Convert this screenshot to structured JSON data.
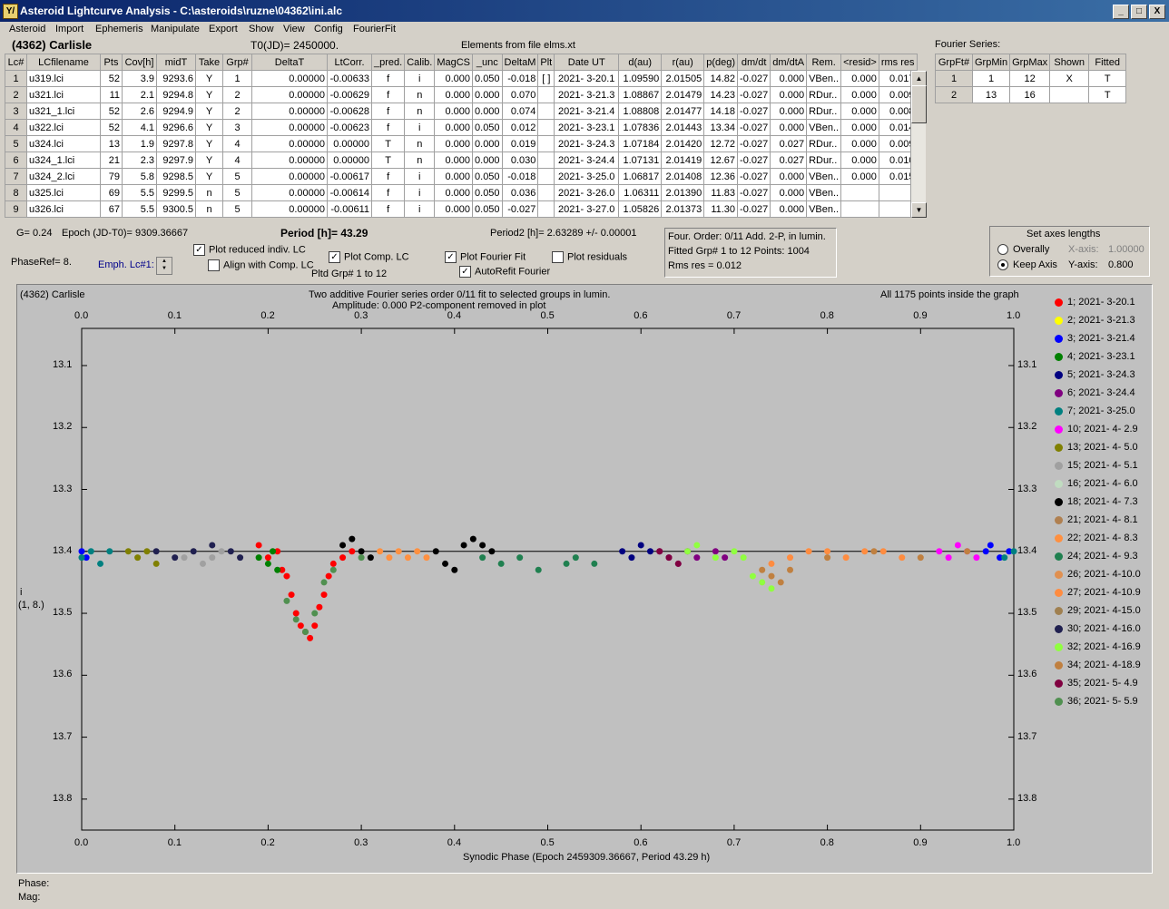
{
  "window": {
    "title": "Asteroid Lightcurve Analysis - C:\\asteroids\\ruzne\\04362\\ini.alc",
    "app_icon": "Y/",
    "min": "_",
    "max": "□",
    "close": "X"
  },
  "menu": [
    "Asteroid",
    "Import",
    "Ephemeris",
    "Manipulate",
    "Export",
    "Show",
    "View",
    "Config",
    "FourierFit"
  ],
  "header": {
    "object": "(4362) Carlisle",
    "t0": "T0(JD)= 2450000.",
    "elements": "Elements from file elms.xt",
    "fourier_label": "Fourier Series:"
  },
  "table": {
    "columns": [
      "Lc#",
      "LCfilename",
      "Pts",
      "Cov[h]",
      "midT",
      "Take",
      "Grp#",
      "DeltaT",
      "LtCorr.",
      "_pred.",
      "Calib.",
      "MagCS",
      "_unc",
      "DeltaM",
      "Plt",
      "Date UT",
      "d(au)",
      "r(au)",
      "p(deg)",
      "dm/dt",
      "dm/dtA",
      "Rem.",
      "<resid>",
      "rms res"
    ],
    "rows": [
      [
        "1",
        "u319.lci",
        "52",
        "3.9",
        "9293.6",
        "Y",
        "1",
        "0.00000",
        "-0.00633",
        "f",
        "i",
        "0.000",
        "0.050",
        "-0.018",
        "[ ]",
        "2021- 3-20.1",
        "1.09590",
        "2.01505",
        "14.82",
        "-0.027",
        "0.000",
        "VBen..",
        "0.000",
        "0.017"
      ],
      [
        "2",
        "u321.lci",
        "11",
        "2.1",
        "9294.8",
        "Y",
        "2",
        "0.00000",
        "-0.00629",
        "f",
        "n",
        "0.000",
        "0.000",
        "0.070",
        "",
        "2021- 3-21.3",
        "1.08867",
        "2.01479",
        "14.23",
        "-0.027",
        "0.000",
        "RDur..",
        "0.000",
        "0.009"
      ],
      [
        "3",
        "u321_1.lci",
        "52",
        "2.6",
        "9294.9",
        "Y",
        "2",
        "0.00000",
        "-0.00628",
        "f",
        "n",
        "0.000",
        "0.000",
        "0.074",
        "",
        "2021- 3-21.4",
        "1.08808",
        "2.01477",
        "14.18",
        "-0.027",
        "0.000",
        "RDur..",
        "0.000",
        "0.008"
      ],
      [
        "4",
        "u322.lci",
        "52",
        "4.1",
        "9296.6",
        "Y",
        "3",
        "0.00000",
        "-0.00623",
        "f",
        "i",
        "0.000",
        "0.050",
        "0.012",
        "",
        "2021- 3-23.1",
        "1.07836",
        "2.01443",
        "13.34",
        "-0.027",
        "0.000",
        "VBen..",
        "0.000",
        "0.014"
      ],
      [
        "5",
        "u324.lci",
        "13",
        "1.9",
        "9297.8",
        "Y",
        "4",
        "0.00000",
        "0.00000",
        "T",
        "n",
        "0.000",
        "0.000",
        "0.019",
        "",
        "2021- 3-24.3",
        "1.07184",
        "2.01420",
        "12.72",
        "-0.027",
        "0.027",
        "RDur..",
        "0.000",
        "0.009"
      ],
      [
        "6",
        "u324_1.lci",
        "21",
        "2.3",
        "9297.9",
        "Y",
        "4",
        "0.00000",
        "0.00000",
        "T",
        "n",
        "0.000",
        "0.000",
        "0.030",
        "",
        "2021- 3-24.4",
        "1.07131",
        "2.01419",
        "12.67",
        "-0.027",
        "0.027",
        "RDur..",
        "0.000",
        "0.010"
      ],
      [
        "7",
        "u324_2.lci",
        "79",
        "5.8",
        "9298.5",
        "Y",
        "5",
        "0.00000",
        "-0.00617",
        "f",
        "i",
        "0.000",
        "0.050",
        "-0.018",
        "",
        "2021- 3-25.0",
        "1.06817",
        "2.01408",
        "12.36",
        "-0.027",
        "0.000",
        "VBen..",
        "0.000",
        "0.015"
      ],
      [
        "8",
        "u325.lci",
        "69",
        "5.5",
        "9299.5",
        "n",
        "5",
        "0.00000",
        "-0.00614",
        "f",
        "i",
        "0.000",
        "0.050",
        "0.036",
        "",
        "2021- 3-26.0",
        "1.06311",
        "2.01390",
        "11.83",
        "-0.027",
        "0.000",
        "VBen..",
        "",
        ""
      ],
      [
        "9",
        "u326.lci",
        "67",
        "5.5",
        "9300.5",
        "n",
        "5",
        "0.00000",
        "-0.00611",
        "f",
        "i",
        "0.000",
        "0.050",
        "-0.027",
        "",
        "2021- 3-27.0",
        "1.05826",
        "2.01373",
        "11.30",
        "-0.027",
        "0.000",
        "VBen..",
        "",
        ""
      ]
    ]
  },
  "fourier_table": {
    "columns": [
      "GrpFt#",
      "GrpMin",
      "GrpMax",
      "Shown",
      "Fitted"
    ],
    "rows": [
      [
        "1",
        "1",
        "12",
        "X",
        "T"
      ],
      [
        "2",
        "13",
        "16",
        "",
        "T"
      ]
    ]
  },
  "controls": {
    "g": "G= 0.24",
    "epoch": "Epoch (JD-T0)= 9309.36667",
    "period": "Period [h]= 43.29",
    "period2": "Period2 [h]= 2.63289 +/- 0.00001",
    "phaseref": "PhaseRef= 8.",
    "emph": "Emph. Lc#1:",
    "plot_reduced": "Plot reduced indiv. LC",
    "align": "Align with Comp. LC",
    "plot_comp": "Plot Comp. LC",
    "pltd_grp": "Pltd Grp#  1   to   12",
    "plot_fourier": "Plot Fourier Fit",
    "autorefit": "AutoRefit Fourier",
    "plot_residuals": "Plot residuals",
    "info1": "Four. Order:  0/11     Add. 2-P, in lumin.",
    "info2": "Fitted Grp# 1 to 12    Points: 1004",
    "info3": "Rms res      = 0.012",
    "axes_title": "Set axes lengths",
    "overally": "Overally",
    "keep_axis": "Keep Axis",
    "xaxis_label": "X-axis:",
    "xaxis_val": "1.00000",
    "yaxis_label": "Y-axis:",
    "yaxis_val": "0.800",
    "check": "✓",
    "spin_up": "▲",
    "spin_down": "▼"
  },
  "plot": {
    "object": "(4362) Carlisle",
    "title1": "Two additive Fourier series order 0/11 fit to selected groups in lumin.",
    "title2": "Amplitude: 0.000                    P2-component removed in plot",
    "inside": "All 1175 points inside the graph",
    "xlabel": "Synodic Phase (Epoch 2459309.36667, Period 43.29 h)",
    "ylabel1": "i",
    "ylabel2": "(1, 8.)",
    "xticks": [
      "0.0",
      "0.1",
      "0.2",
      "0.3",
      "0.4",
      "0.5",
      "0.6",
      "0.7",
      "0.8",
      "0.9",
      "1.0"
    ],
    "yticks": [
      "13.1",
      "13.2",
      "13.3",
      "13.4",
      "13.5",
      "13.6",
      "13.7",
      "13.8"
    ]
  },
  "legend": [
    {
      "label": "1; 2021- 3-20.1",
      "color": "#ff0000"
    },
    {
      "label": "2; 2021- 3-21.3",
      "color": "#ffff00"
    },
    {
      "label": "3; 2021- 3-21.4",
      "color": "#0000ff"
    },
    {
      "label": "4; 2021- 3-23.1",
      "color": "#008000"
    },
    {
      "label": "5; 2021- 3-24.3",
      "color": "#000080"
    },
    {
      "label": "6; 2021- 3-24.4",
      "color": "#800080"
    },
    {
      "label": "7; 2021- 3-25.0",
      "color": "#008080"
    },
    {
      "label": "10; 2021- 4- 2.9",
      "color": "#ff00ff"
    },
    {
      "label": "13; 2021- 4- 5.0",
      "color": "#808000"
    },
    {
      "label": "15; 2021- 4- 5.1",
      "color": "#a0a0a0"
    },
    {
      "label": "16; 2021- 4- 6.0",
      "color": "#c0dcc0"
    },
    {
      "label": "18; 2021- 4- 7.3",
      "color": "#000000"
    },
    {
      "label": "21; 2021- 4- 8.1",
      "color": "#b08050"
    },
    {
      "label": "22; 2021- 4- 8.3",
      "color": "#ff9040"
    },
    {
      "label": "24; 2021- 4- 9.3",
      "color": "#208050"
    },
    {
      "label": "26; 2021- 4-10.0",
      "color": "#e09050"
    },
    {
      "label": "27; 2021- 4-10.9",
      "color": "#ff8c40"
    },
    {
      "label": "29; 2021- 4-15.0",
      "color": "#a08050"
    },
    {
      "label": "30; 2021- 4-16.0",
      "color": "#202050"
    },
    {
      "label": "32; 2021- 4-16.9",
      "color": "#90ff40"
    },
    {
      "label": "34; 2021- 4-18.9",
      "color": "#c08040"
    },
    {
      "label": "35; 2021- 5- 4.9",
      "color": "#800040"
    },
    {
      "label": "36; 2021- 5- 5.9",
      "color": "#509050"
    }
  ],
  "status": {
    "phase": "Phase:",
    "mag": "Mag:"
  },
  "chart_data": {
    "type": "scatter",
    "title": "Two additive Fourier series order 0/11 fit to selected groups in lumin.",
    "xlabel": "Synodic Phase (Epoch 2459309.36667, Period 43.29 h)",
    "ylabel": "i (1, 8.)",
    "xlim": [
      0.0,
      1.0
    ],
    "ylim": [
      13.04,
      13.85
    ],
    "y_inverted": true,
    "fit_line_y": 13.4,
    "series": [
      {
        "name": "1; 2021- 3-20.1",
        "color": "#ff0000",
        "points": [
          [
            0.19,
            13.39
          ],
          [
            0.2,
            13.41
          ],
          [
            0.21,
            13.4
          ],
          [
            0.215,
            13.43
          ],
          [
            0.22,
            13.44
          ],
          [
            0.225,
            13.47
          ],
          [
            0.23,
            13.5
          ],
          [
            0.235,
            13.52
          ],
          [
            0.24,
            13.53
          ],
          [
            0.245,
            13.54
          ],
          [
            0.25,
            13.52
          ],
          [
            0.255,
            13.49
          ],
          [
            0.26,
            13.47
          ],
          [
            0.265,
            13.44
          ],
          [
            0.27,
            13.42
          ],
          [
            0.28,
            13.41
          ],
          [
            0.29,
            13.4
          ]
        ]
      },
      {
        "name": "3; 2021- 3-21.4",
        "color": "#0000ff",
        "points": [
          [
            0.0,
            13.4
          ],
          [
            0.005,
            13.41
          ],
          [
            0.97,
            13.4
          ],
          [
            0.975,
            13.39
          ],
          [
            0.985,
            13.41
          ],
          [
            0.995,
            13.4
          ]
        ]
      },
      {
        "name": "4; 2021- 3-23.1",
        "color": "#008000",
        "points": [
          [
            0.19,
            13.41
          ],
          [
            0.2,
            13.42
          ],
          [
            0.205,
            13.4
          ],
          [
            0.21,
            13.43
          ]
        ]
      },
      {
        "name": "5; 2021- 3-24.3",
        "color": "#000080",
        "points": [
          [
            0.58,
            13.4
          ],
          [
            0.59,
            13.41
          ],
          [
            0.6,
            13.39
          ],
          [
            0.61,
            13.4
          ]
        ]
      },
      {
        "name": "6; 2021- 3-24.4",
        "color": "#800080",
        "points": [
          [
            0.62,
            13.4
          ],
          [
            0.63,
            13.41
          ],
          [
            0.64,
            13.42
          ],
          [
            0.65,
            13.4
          ],
          [
            0.66,
            13.41
          ],
          [
            0.68,
            13.4
          ],
          [
            0.69,
            13.41
          ]
        ]
      },
      {
        "name": "7; 2021- 3-25.0",
        "color": "#008080",
        "points": [
          [
            0.0,
            13.41
          ],
          [
            0.01,
            13.4
          ],
          [
            0.02,
            13.42
          ],
          [
            0.03,
            13.4
          ],
          [
            0.99,
            13.41
          ],
          [
            1.0,
            13.4
          ]
        ]
      },
      {
        "name": "10; 2021- 4- 2.9",
        "color": "#ff00ff",
        "points": [
          [
            0.92,
            13.4
          ],
          [
            0.93,
            13.41
          ],
          [
            0.94,
            13.39
          ],
          [
            0.95,
            13.4
          ],
          [
            0.96,
            13.41
          ]
        ]
      },
      {
        "name": "13; 2021- 4- 5.0",
        "color": "#808000",
        "points": [
          [
            0.05,
            13.4
          ],
          [
            0.06,
            13.41
          ],
          [
            0.07,
            13.4
          ],
          [
            0.08,
            13.42
          ]
        ]
      },
      {
        "name": "15; 2021- 4- 5.1",
        "color": "#a0a0a0",
        "points": [
          [
            0.11,
            13.41
          ],
          [
            0.12,
            13.4
          ],
          [
            0.13,
            13.42
          ],
          [
            0.14,
            13.41
          ],
          [
            0.15,
            13.4
          ]
        ]
      },
      {
        "name": "18; 2021- 4- 7.3",
        "color": "#000000",
        "points": [
          [
            0.28,
            13.39
          ],
          [
            0.29,
            13.38
          ],
          [
            0.3,
            13.4
          ],
          [
            0.31,
            13.41
          ],
          [
            0.38,
            13.4
          ],
          [
            0.39,
            13.42
          ],
          [
            0.4,
            13.43
          ],
          [
            0.41,
            13.39
          ],
          [
            0.42,
            13.38
          ],
          [
            0.43,
            13.39
          ],
          [
            0.44,
            13.4
          ]
        ]
      },
      {
        "name": "22; 2021- 4- 8.3",
        "color": "#ff9040",
        "points": [
          [
            0.32,
            13.4
          ],
          [
            0.33,
            13.41
          ],
          [
            0.34,
            13.4
          ],
          [
            0.35,
            13.41
          ],
          [
            0.36,
            13.4
          ],
          [
            0.37,
            13.41
          ]
        ]
      },
      {
        "name": "24; 2021- 4- 9.3",
        "color": "#208050",
        "points": [
          [
            0.43,
            13.41
          ],
          [
            0.45,
            13.42
          ],
          [
            0.47,
            13.41
          ],
          [
            0.49,
            13.43
          ],
          [
            0.52,
            13.42
          ],
          [
            0.53,
            13.41
          ],
          [
            0.55,
            13.42
          ]
        ]
      },
      {
        "name": "27; 2021- 4-10.9",
        "color": "#ff8c40",
        "points": [
          [
            0.74,
            13.42
          ],
          [
            0.76,
            13.41
          ],
          [
            0.78,
            13.4
          ],
          [
            0.8,
            13.4
          ],
          [
            0.82,
            13.41
          ],
          [
            0.84,
            13.4
          ],
          [
            0.86,
            13.4
          ],
          [
            0.88,
            13.41
          ]
        ]
      },
      {
        "name": "30; 2021- 4-16.0",
        "color": "#202050",
        "points": [
          [
            0.08,
            13.4
          ],
          [
            0.1,
            13.41
          ],
          [
            0.12,
            13.4
          ],
          [
            0.14,
            13.39
          ],
          [
            0.16,
            13.4
          ],
          [
            0.17,
            13.41
          ]
        ]
      },
      {
        "name": "32; 2021- 4-16.9",
        "color": "#90ff40",
        "points": [
          [
            0.65,
            13.4
          ],
          [
            0.66,
            13.39
          ],
          [
            0.68,
            13.41
          ],
          [
            0.7,
            13.4
          ],
          [
            0.71,
            13.41
          ],
          [
            0.72,
            13.44
          ],
          [
            0.73,
            13.45
          ],
          [
            0.74,
            13.46
          ]
        ]
      },
      {
        "name": "34; 2021- 4-18.9",
        "color": "#c08040",
        "points": [
          [
            0.73,
            13.43
          ],
          [
            0.74,
            13.44
          ],
          [
            0.75,
            13.45
          ],
          [
            0.76,
            13.43
          ],
          [
            0.8,
            13.41
          ],
          [
            0.85,
            13.4
          ],
          [
            0.9,
            13.41
          ],
          [
            0.95,
            13.4
          ]
        ]
      },
      {
        "name": "35; 2021- 5- 4.9",
        "color": "#800040",
        "points": [
          [
            0.62,
            13.4
          ],
          [
            0.63,
            13.41
          ],
          [
            0.64,
            13.42
          ]
        ]
      },
      {
        "name": "36; 2021- 5- 5.9",
        "color": "#509050",
        "points": [
          [
            0.22,
            13.48
          ],
          [
            0.23,
            13.51
          ],
          [
            0.24,
            13.53
          ],
          [
            0.25,
            13.5
          ],
          [
            0.26,
            13.45
          ],
          [
            0.27,
            13.43
          ],
          [
            0.3,
            13.41
          ]
        ]
      }
    ]
  }
}
